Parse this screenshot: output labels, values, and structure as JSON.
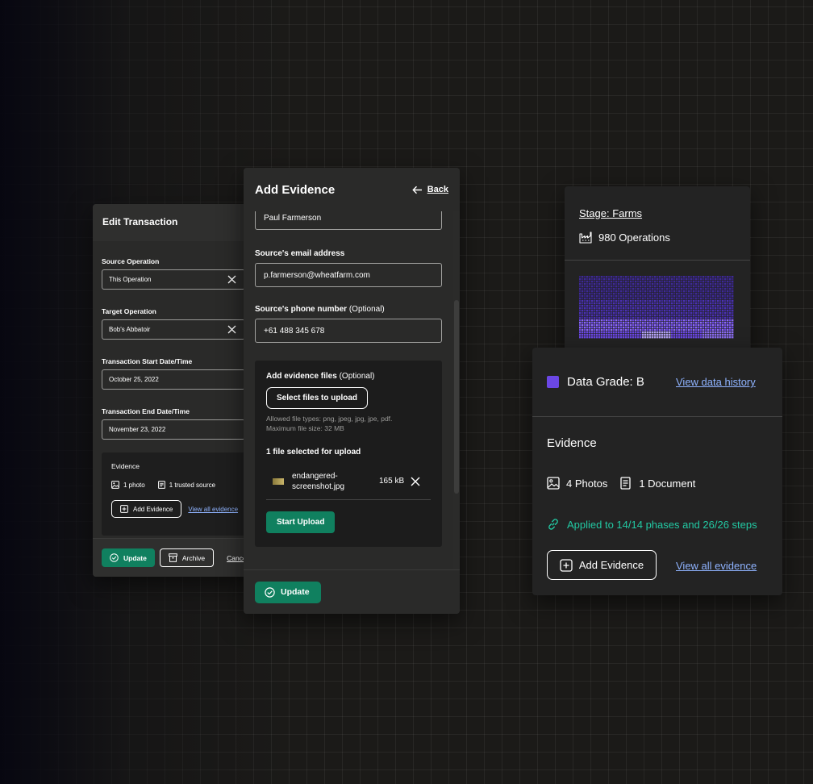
{
  "edit_transaction": {
    "title": "Edit Transaction",
    "source_operation_label": "Source Operation",
    "source_operation_value": "This Operation",
    "target_operation_label": "Target Operation",
    "target_operation_value": "Bob's Abbatoir",
    "start_label": "Transaction Start Date/Time",
    "start_value": "October 25, 2022",
    "end_label": "Transaction End Date/Time",
    "end_value": "November 23, 2022",
    "evidence_title": "Evidence",
    "photos": "1 photo",
    "sources": "1 trusted source",
    "add_evidence": "Add Evidence",
    "view_all": "View all evidence",
    "update": "Update",
    "archive": "Archive",
    "cancel": "Cancel"
  },
  "add_evidence": {
    "title": "Add Evidence",
    "back": "Back",
    "source_name_value": "Paul Farmerson",
    "email_label": "Source's email address",
    "email_value": "p.farmerson@wheatfarm.com",
    "phone_label": "Source's phone number",
    "phone_optional": "(Optional)",
    "phone_value": "+61 488 345 678",
    "files_label": "Add evidence files",
    "files_optional": "(Optional)",
    "select_button": "Select files to upload",
    "allowed_types": "Allowed file types: png, jpeg, jpg, jpe, pdf.",
    "max_size": "Maximum file size: 32 MB",
    "selected_count": "1 file selected for upload",
    "file_name_line1": "endangered-",
    "file_name_line2": "screenshot.jpg",
    "file_size": "165 kB",
    "start_upload": "Start Upload",
    "update": "Update"
  },
  "stage": {
    "title": "Stage: Farms",
    "operations": "980 Operations"
  },
  "data_grade": {
    "grade": "Data Grade: B",
    "grade_color": "#6b47e5",
    "view_history": "View data history",
    "evidence_heading": "Evidence",
    "photos": "4 Photos",
    "documents": "1 Document",
    "applied": "Applied to 14/14 phases and 26/26 steps",
    "add_evidence": "Add Evidence",
    "view_all": "View all evidence"
  },
  "colors": {
    "accent_green": "#10805f",
    "link_blue": "#8fb3ff",
    "teal": "#22c9a3",
    "purple": "#6b47e5"
  }
}
